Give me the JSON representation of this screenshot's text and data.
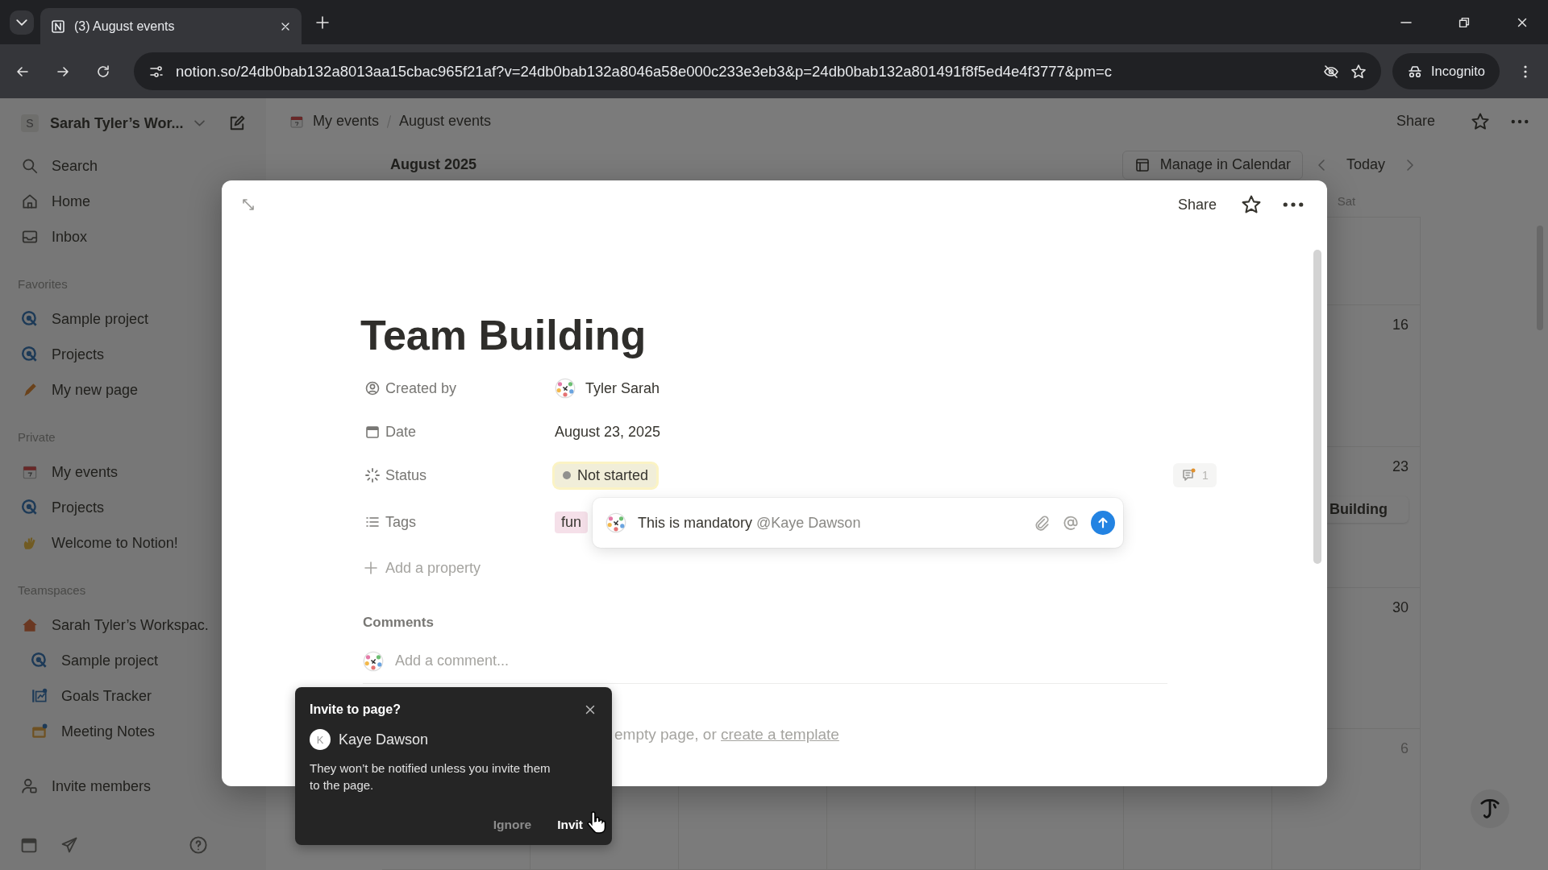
{
  "browser": {
    "tab_title": "(3) August events",
    "url": "notion.so/24db0bab132a8013aa15cbac965f21af?v=24db0bab132a8046a58e000c233e3eb3&p=24db0bab132a801491f8f5ed4e4f3777&pm=c",
    "incognito_label": "Incognito"
  },
  "sidebar": {
    "workspace": {
      "initial": "S",
      "name": "Sarah Tyler’s Wor..."
    },
    "nav": [
      {
        "label": "Search"
      },
      {
        "label": "Home"
      },
      {
        "label": "Inbox"
      }
    ],
    "sections": [
      {
        "title": "Favorites",
        "items": [
          {
            "label": "Sample project"
          },
          {
            "label": "Projects"
          },
          {
            "label": "My new page"
          }
        ]
      },
      {
        "title": "Private",
        "items": [
          {
            "label": "My events"
          },
          {
            "label": "Projects"
          },
          {
            "label": "Welcome to Notion!"
          }
        ]
      },
      {
        "title": "Teamspaces",
        "items": [
          {
            "label": "Sarah Tyler’s Workspac.",
            "children": [
              {
                "label": "Sample project"
              },
              {
                "label": "Goals Tracker"
              },
              {
                "label": "Meeting Notes"
              }
            ]
          }
        ]
      }
    ],
    "invite_label": "Invite members"
  },
  "topbar": {
    "breadcrumbs": [
      "My events",
      "August events"
    ],
    "share": "Share"
  },
  "calendar": {
    "title": "August 2025",
    "manage_button": "Manage in Calendar",
    "today_button": "Today",
    "weekday": "Sat",
    "weeks": [
      {
        "day": "16",
        "in_month": true
      },
      {
        "day": "23",
        "in_month": true,
        "event": "Building"
      },
      {
        "day": "30",
        "in_month": true
      },
      {
        "day": "6",
        "in_month": false
      }
    ]
  },
  "page_modal": {
    "share": "Share",
    "title": "Team Building",
    "properties": [
      {
        "kind": "person",
        "label": "Created by",
        "value": "Tyler Sarah"
      },
      {
        "kind": "date",
        "label": "Date",
        "value": "August 23, 2025"
      },
      {
        "kind": "status",
        "label": "Status",
        "value": "Not started"
      },
      {
        "kind": "tags",
        "label": "Tags",
        "tags": [
          "fun"
        ]
      }
    ],
    "add_property": "Add a property",
    "comments_heading": "Comments",
    "comment_placeholder": "Add a comment...",
    "comment_count": "1",
    "draft_comment": {
      "text": "This is mandatory",
      "mention": "@Kaye Dawson"
    },
    "empty_hint": {
      "text": "empty page, or",
      "link": "create a template"
    }
  },
  "invite_popup": {
    "title": "Invite to page?",
    "person": {
      "initial": "K",
      "name": "Kaye Dawson"
    },
    "message": "They won’t be notified unless you invite them to the page.",
    "buttons": [
      {
        "label": "Ignore",
        "kind": "secondary"
      },
      {
        "label": "Invit",
        "kind": "primary"
      }
    ]
  }
}
